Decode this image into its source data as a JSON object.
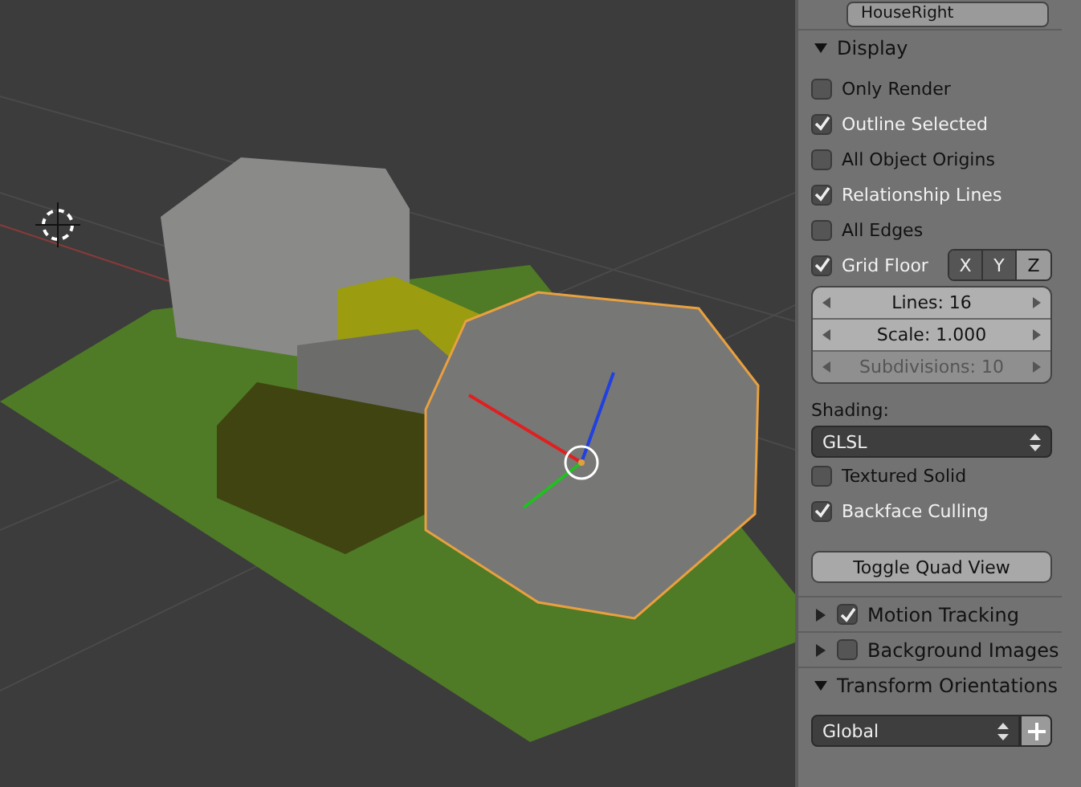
{
  "object_field": {
    "value": "HouseRight"
  },
  "display": {
    "title": "Display",
    "expanded": true,
    "options": [
      {
        "label": "Only Render",
        "checked": false
      },
      {
        "label": "Outline Selected",
        "checked": true
      },
      {
        "label": "All Object Origins",
        "checked": false
      },
      {
        "label": "Relationship Lines",
        "checked": true
      },
      {
        "label": "All Edges",
        "checked": false
      }
    ],
    "grid_floor": {
      "label": "Grid Floor",
      "checked": true,
      "axes": [
        {
          "label": "X",
          "selected": true
        },
        {
          "label": "Y",
          "selected": true
        },
        {
          "label": "Z",
          "selected": false
        }
      ]
    },
    "fields": [
      {
        "label": "Lines: 16",
        "disabled": false
      },
      {
        "label": "Scale: 1.000",
        "disabled": false
      },
      {
        "label": "Subdivisions: 10",
        "disabled": true
      }
    ],
    "shading": {
      "label": "Shading:",
      "value": "GLSL"
    },
    "shading_options": [
      {
        "label": "Textured Solid",
        "checked": false
      },
      {
        "label": "Backface Culling",
        "checked": true
      }
    ],
    "button": "Toggle Quad View"
  },
  "collapsed_panels": [
    {
      "title": "Motion Tracking",
      "expanded": false,
      "checked": true
    },
    {
      "title": "Background Images",
      "expanded": false,
      "checked": false
    }
  ],
  "transform_orientations": {
    "title": "Transform Orientations",
    "expanded": true,
    "value": "Global"
  }
}
